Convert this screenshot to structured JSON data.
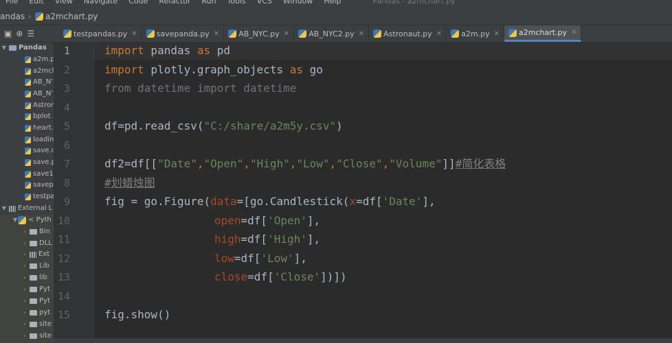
{
  "menu": [
    "File",
    "Edit",
    "View",
    "Navigate",
    "Code",
    "Refactor",
    "Run",
    "Tools",
    "VCS",
    "Window",
    "Help"
  ],
  "window_title": "Pandas - a2mchart.py",
  "breadcrumb": [
    "andas",
    "a2mchart.py"
  ],
  "tabs": [
    {
      "label": "testpandas.py",
      "active": false
    },
    {
      "label": "savepanda.py",
      "active": false
    },
    {
      "label": "AB_NYC.py",
      "active": false
    },
    {
      "label": "AB_NYC2.py",
      "active": false
    },
    {
      "label": "Astronaut.py",
      "active": false
    },
    {
      "label": "a2m.py",
      "active": false
    },
    {
      "label": "a2mchart.py",
      "active": true
    }
  ],
  "tree": {
    "root": "Pandas",
    "files": [
      "a2m.p",
      "a2mcl",
      "AB_N’",
      "AB_N’",
      "Astron",
      "bplot",
      "heart.",
      "loadin",
      "save.c",
      "save.p",
      "save1.",
      "savep",
      "testpa"
    ],
    "external": "External L",
    "python": "< Pyth",
    "libs": [
      "Bin",
      "DLL",
      "Ext",
      "Lib",
      "lib",
      "Pyt",
      "Pyt",
      "pyt",
      "site",
      "site"
    ]
  },
  "line_numbers": [
    "1",
    "2",
    "3",
    "4",
    "5",
    "6",
    "7",
    "8",
    "9",
    "10",
    "11",
    "12",
    "13",
    "14",
    "15"
  ],
  "code": {
    "l1": {
      "kw1": "import",
      "mod": " pandas ",
      "kw2": "as",
      "alias": " pd"
    },
    "l2": {
      "kw1": "import",
      "mod": " plotly.graph_objects ",
      "kw2": "as",
      "alias": " go"
    },
    "l3": "from datetime import datetime",
    "l5": {
      "pre": "df=pd.read_csv(",
      "str": "\"C:/share/a2m5y.csv\"",
      "post": ")"
    },
    "l7": {
      "pre": "df2=df[[",
      "s1": "\"Date\"",
      "s2": "\"Open\"",
      "s3": "\"High\"",
      "s4": "\"Low\"",
      "s5": "\"Close\"",
      "s6": "\"Volume\"",
      "post": "]]",
      "comment": "#简化表格"
    },
    "l8": "#划蜡烛图",
    "l9": {
      "pre": "fig = go.Figure(",
      "p1": "data",
      "mid": "=[go.Candlestick(",
      "p2": "x",
      "mid2": "=df[",
      "s": "'Date'",
      "post": "],"
    },
    "l10": {
      "p": "open",
      "mid": "=df[",
      "s": "'Open'",
      "post": "],"
    },
    "l11": {
      "p": "high",
      "mid": "=df[",
      "s": "'High'",
      "post": "],"
    },
    "l12": {
      "p": "low",
      "mid": "=df[",
      "s": "'Low'",
      "post": "],"
    },
    "l13": {
      "p": "close",
      "mid": "=df[",
      "s": "'Close'",
      "post": "])])"
    },
    "l15": "fig.show()"
  },
  "colors": {
    "keyword": "#cc7832",
    "string": "#6a8759",
    "comment": "#808080",
    "param": "#aa4926",
    "text": "#a9b7c6",
    "background": "#2b2b2b"
  }
}
